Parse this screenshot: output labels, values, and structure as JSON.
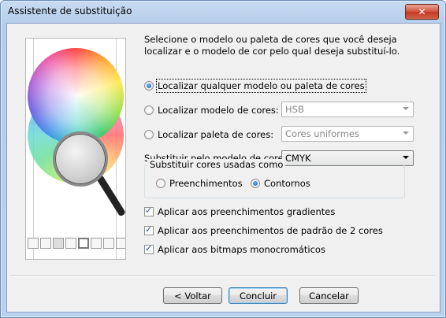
{
  "window": {
    "title": "Assistente de substituição",
    "close_symbol": "✕"
  },
  "intro": {
    "line1": "Selecione o modelo ou paleta de cores que você deseja",
    "line2": "localizar e o modelo de cor pelo qual deseja substituí-lo."
  },
  "options": {
    "find_any": {
      "label": "Localizar qualquer modelo ou paleta de cores",
      "selected": true
    },
    "find_model": {
      "label": "Localizar modelo de cores:",
      "dropdown_value": "HSB",
      "selected": false
    },
    "find_palette": {
      "label": "Localizar paleta de cores:",
      "dropdown_value": "Cores uniformes",
      "selected": false
    }
  },
  "replace": {
    "label": "Substituir pelo modelo de cores:",
    "dropdown_value": "CMYK"
  },
  "replace_group": {
    "legend": "Substituir cores usadas como",
    "fills_label": "Preenchimentos",
    "outlines_label": "Contornos",
    "selected": "Contornos"
  },
  "checks": [
    {
      "label": "Aplicar aos preenchimentos gradientes",
      "checked": true
    },
    {
      "label": "Aplicar aos preenchimentos de padrão de 2 cores",
      "checked": true
    },
    {
      "label": "Aplicar aos bitmaps monocromáticos",
      "checked": true
    }
  ],
  "buttons": {
    "back": "< Voltar",
    "finish": "Concluir",
    "cancel": "Cancelar"
  },
  "icons": {
    "illustration": "color-wheel-magnifier-illustration"
  },
  "colors": {
    "title_bar": "#b9d1ec",
    "client_bg": "#f0f0f0",
    "close_button": "#c13a22"
  }
}
